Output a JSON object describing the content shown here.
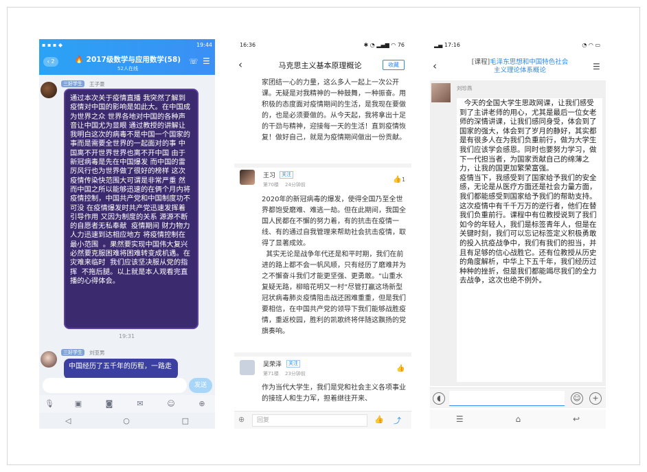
{
  "phone1": {
    "status": {
      "time": "19:44"
    },
    "header": {
      "unread": "2",
      "group_title": "🔥 2017级数学与应用数学(58)",
      "online": "52人在线"
    },
    "msg1": {
      "tag": "三好学生",
      "name": "王子豪",
      "text": "通过本次关于疫情直播 我突然了解到疫情对中国的影响是如此大。在中国成为世界之众 世界各地对中国的各种声音让中国尤为显眼 通过教授的讲解让我明白这次的病毒不是中国一个国家的事而是需要全世界的一起面对的事 中国离不开世界世界也离不开中国 由于新冠病毒是先在中国爆发 而中国的雷厉风行也为世界做了很好的榜样 这次疫情传染快范围大可谓是非常严重 然而中国之所以能够迅速的在俩个月内将疫情控制，中国共产党和中国制度功不可没 在疫情爆发时共产党迅速发挥着引导作用 又因为制度的关系 源源不断的自愿者无私奉献  疫情期间 财力物力人力迅速到达相应地方 将疫情控制在最小范围  。果然要实现中国伟大复兴 必然要克服困难将困难转变成机遇。在灾难来临时  我们应该坚决服从党的指挥  不拖后腿。以上就是本人观看完直播的心得体会。"
    },
    "time_sep": "19:31",
    "msg2": {
      "tag": "三好学生",
      "name": "刘亚男",
      "text": "中国经历了五千年的历程，一路走"
    },
    "input": {
      "send": "发送"
    }
  },
  "phone2": {
    "status": {
      "time": "16:36",
      "battery": "76"
    },
    "header": {
      "title": "马克思主义基本原理概论",
      "favorite": "收藏"
    },
    "post0": {
      "text": "家团结一心的力量，这么多人一起上一次公开课。无疑是对我精神的一种鼓舞，一种振奋。用积极的态度面对疫情期间的生活，是我现在要做的，也是必须要做的。从今天起，我将拿出十足的干劲与精神，迎接每一天的生活！直到疫情恢复！做好自己，就是为疫情期间做出一份贡献。"
    },
    "post1": {
      "name": "王习",
      "follow": "关注",
      "floor": "第70楼",
      "ago": "24分钟前",
      "likes": "1",
      "text": "2020年的新冠病毒的爆发，使得全国乃至全世界都饱受磨难、难逃一劫。但在此期间，我国全国人民都在不懈的努力着，有的抗击在疫情一线、有的通过自我管理来帮助社会抗击疫情，取得了显著成效。\n  其实无论是战争年代还是和平时期，我们在前进的路上都不会一帆风顺，只有经历了磨难并为之不懈奋斗我们才能更坚强、更勇敢。“山重水复疑无路，柳暗花明又一村”尽管打赢这场新型冠状病毒肺炎疫情阻击战还困难重重，但是我们要相信，在中国共产党的领导下我们能够战胜疫情，重返校园，胜利的凯歌终将伴随这飘扬的党旗奏响。"
    },
    "post2": {
      "name": "吴荣泽",
      "follow": "关注",
      "floor": "第71楼",
      "ago": "23分钟前",
      "text": "作为当代大学生，我们是党和社会主义各项事业的接班人和生力军，担着继往开来、"
    },
    "reply_placeholder": "回复"
  },
  "phone3": {
    "status": {
      "time": "17:16"
    },
    "header": {
      "prefix": "[课程]",
      "title_line1": "毛泽东思想和中国特色社会",
      "title_line2": "主义理论体系概论"
    },
    "msg": {
      "name": "刘珍燕",
      "text": "  今天的全国大学生思政网课，让我们感受到了主讲老师的用心，尤其是最后一位女老师的深情讲课，让我们感同身受，体会到了国家的强大，体会到了岁月的静好，其实都是有很多人在为我们负重前行，做为大学生我们应该学会感恩。同时也要努力学习，做下一代担当者，为国家贡献自己的绵薄之力，让我的国更加繁荣富强。\n疫情当下，我感受到了国家给予我们的安全感，无论是从医疗方面还是社会力量方面，我们都能感受到国家给予我们的帮助支持。这次疫情中有千千万万的逆行者，他们在替我们负重前行。课程中有位教授说到了我们如今的年轻人，我们是标签青年人，但是在关键时刻，我们可以忘记标签定义积极勇敢的投入抗疫战争中，我们有我们的担当，并且有足够的信心战胜它。还有位教授从历史的角度解析，中华上下五千年，我们经历过种种的挫折，但是我们都能竭尽我们的全力去战争，这次也绝不例外。"
    }
  }
}
